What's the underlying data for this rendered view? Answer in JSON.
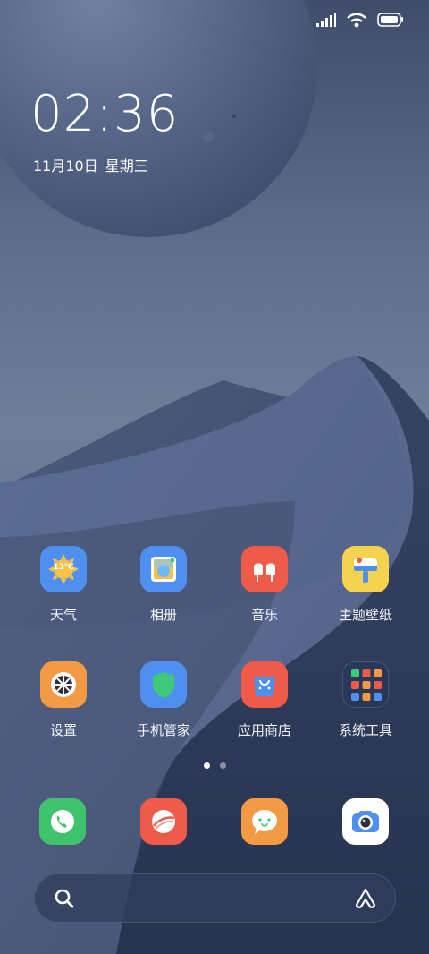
{
  "status_bar": {
    "signal_icon": "cellular-signal-icon",
    "wifi_icon": "wifi-icon",
    "battery_icon": "battery-icon"
  },
  "clock": {
    "time": "02:36",
    "date": "11月10日",
    "weekday": "星期三"
  },
  "apps": [
    {
      "label": "天气",
      "icon": "weather-icon",
      "badge": "13℃",
      "color": "#4f8ff0"
    },
    {
      "label": "相册",
      "icon": "gallery-icon",
      "color": "#4f8ff0"
    },
    {
      "label": "音乐",
      "icon": "music-icon",
      "color": "#ee5b48"
    },
    {
      "label": "主题壁纸",
      "icon": "themes-icon",
      "color": "#f6d34e"
    },
    {
      "label": "设置",
      "icon": "settings-icon",
      "color": "#f39a44"
    },
    {
      "label": "手机管家",
      "icon": "security-icon",
      "color": "#4f8ff0"
    },
    {
      "label": "应用商店",
      "icon": "app-store-icon",
      "color": "#ee5b48"
    },
    {
      "label": "系统工具",
      "icon": "folder-icon",
      "color": "#ffffff"
    }
  ],
  "pages": {
    "count": 2,
    "current": 1
  },
  "dock": [
    {
      "name": "phone",
      "icon": "phone-icon",
      "color": "#3fc36c"
    },
    {
      "name": "browser",
      "icon": "browser-icon",
      "color": "#ee5b48"
    },
    {
      "name": "messages",
      "icon": "messages-icon",
      "color": "#f39a44"
    },
    {
      "name": "camera",
      "icon": "camera-icon",
      "color": "#ffffff"
    }
  ],
  "search": {
    "icon": "search-icon",
    "assistant_icon": "assistant-icon"
  }
}
